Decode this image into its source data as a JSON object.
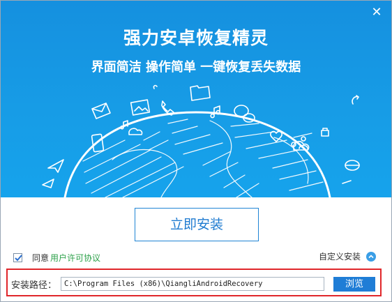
{
  "window": {
    "close_glyph": "✕"
  },
  "banner": {
    "title": "强力安卓恢复精灵",
    "subtitle": "界面简洁 操作简单 一键恢复丢失数据"
  },
  "install": {
    "button_label": "立即安装"
  },
  "agreement": {
    "checked": true,
    "agree_text": "同意",
    "license_link": "用户许可协议"
  },
  "custom_install": {
    "label": "自定义安装",
    "icon": "chevron-up-icon"
  },
  "path": {
    "label": "安装路径：",
    "value": "C:\\Program Files (x86)\\QiangliAndroidRecovery",
    "browse_label": "浏览"
  },
  "colors": {
    "banner_blue": "#179ce6",
    "button_border": "#1f84d4",
    "link_green": "#2da14a",
    "highlight_red": "#e0262a",
    "browse_blue": "#1f7dd6"
  }
}
